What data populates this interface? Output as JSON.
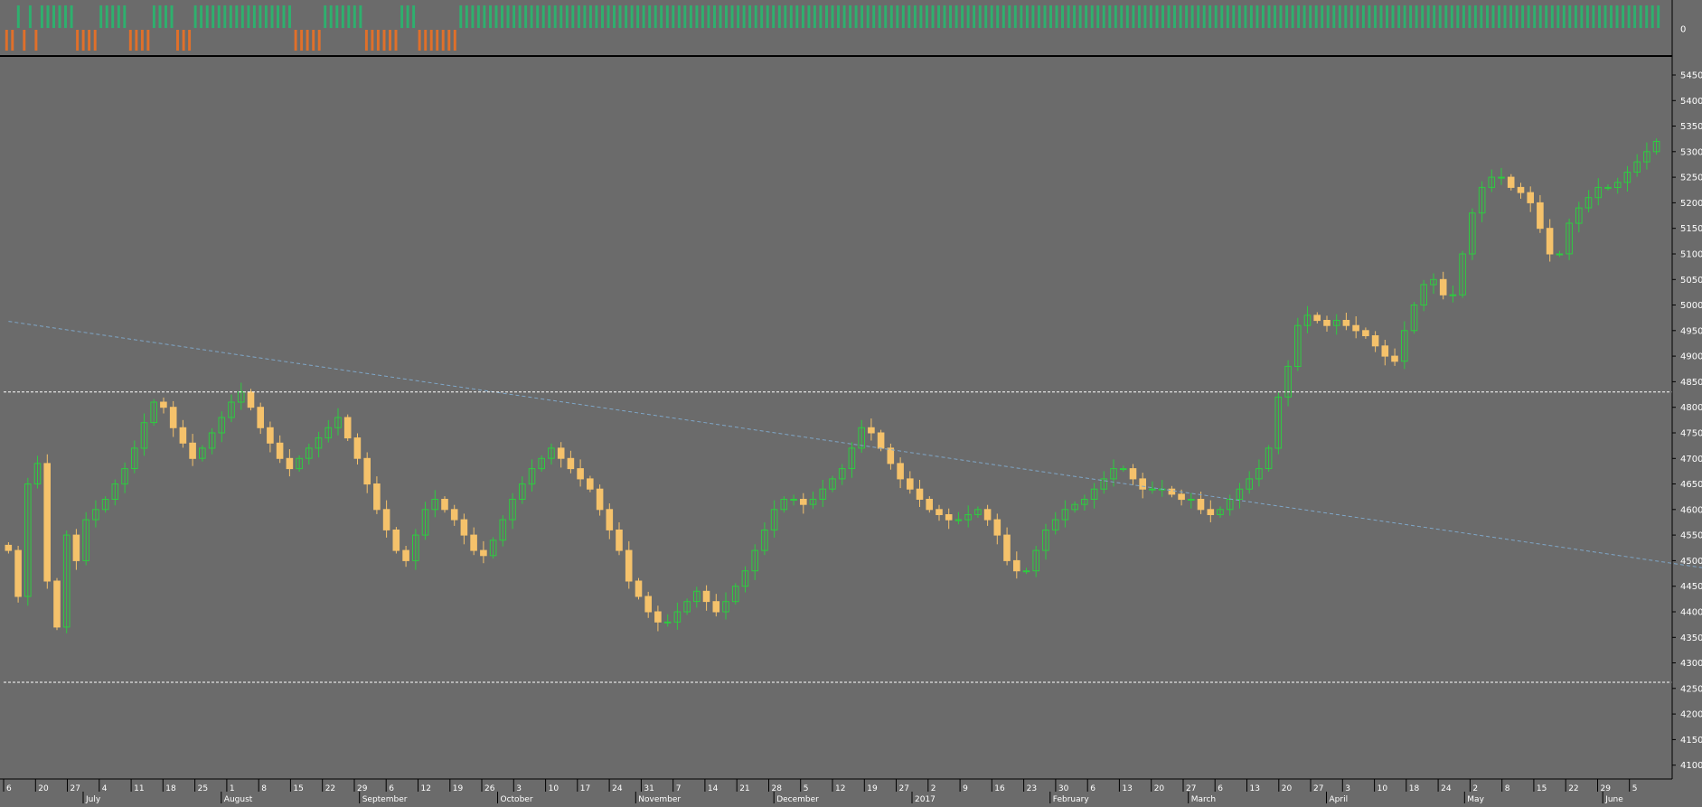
{
  "colors": {
    "background": "#6b6b6b",
    "up": "#2ecc40",
    "down": "#f5c26b",
    "volume_up": "#2eb06e",
    "volume_down": "#e0702a",
    "divider": "#000000",
    "trendline": "#7fa6c7",
    "level_line": "#ffffff",
    "axis_text": "#ffffff"
  },
  "chart_data": [
    {
      "type": "bar",
      "panel": "indicator",
      "ylim": [
        -1,
        1
      ],
      "ytick_labels": [
        {
          "value": 0,
          "label": "0"
        }
      ],
      "up_value": 1,
      "down_value": -1,
      "signals": [
        -1,
        -1,
        1,
        -1,
        1,
        -1,
        1,
        1,
        1,
        1,
        1,
        1,
        -1,
        -1,
        -1,
        -1,
        1,
        1,
        1,
        1,
        1,
        -1,
        -1,
        -1,
        -1,
        1,
        1,
        1,
        1,
        -1,
        -1,
        -1,
        1,
        1,
        1,
        1,
        1,
        1,
        1,
        1,
        1,
        1,
        1,
        1,
        1,
        1,
        1,
        1,
        1,
        -1,
        -1,
        -1,
        -1,
        -1,
        1,
        1,
        1,
        1,
        1,
        1,
        1,
        -1,
        -1,
        -1,
        -1,
        -1,
        -1,
        1,
        1,
        1,
        -1,
        -1,
        -1,
        -1,
        -1,
        -1,
        -1,
        1,
        1,
        1,
        1,
        1,
        1,
        1,
        1,
        1,
        1,
        1,
        1,
        1,
        1,
        1,
        1,
        1,
        1,
        1,
        1,
        1,
        1,
        1,
        1,
        1,
        1,
        1,
        1,
        1,
        1,
        1,
        1,
        1,
        1,
        1,
        1,
        1,
        1,
        1,
        1,
        1,
        1,
        1,
        1,
        1,
        1,
        1,
        1,
        1,
        1,
        1,
        1,
        1,
        1,
        1,
        1,
        1,
        1,
        1,
        1,
        1,
        1,
        1,
        1,
        1,
        1,
        1,
        1,
        1,
        1,
        1,
        1,
        1,
        1,
        1,
        1,
        1,
        1,
        1,
        1,
        1,
        1,
        1,
        1,
        1,
        1,
        1,
        1,
        1,
        1,
        1,
        1,
        1,
        1,
        1,
        1,
        1,
        1,
        1,
        1,
        1,
        1,
        1,
        1,
        1,
        1,
        1,
        1,
        1,
        1,
        1,
        1,
        1,
        1,
        1,
        1,
        1,
        1,
        1,
        1,
        1,
        1,
        1,
        1,
        1,
        1,
        1,
        1,
        1,
        1,
        1,
        1,
        1,
        1,
        1,
        1,
        1,
        1,
        1,
        1,
        1,
        1,
        1,
        1,
        1,
        1,
        1,
        1,
        1,
        1,
        1,
        1,
        1,
        1,
        1,
        1,
        1,
        1,
        1,
        1,
        1,
        1,
        1,
        1,
        1,
        1,
        1,
        1,
        1,
        1,
        1,
        1,
        1,
        1,
        1,
        1,
        1,
        1,
        1,
        1,
        1,
        1,
        1,
        1,
        1,
        1,
        1,
        1,
        1,
        1,
        1,
        1,
        1,
        1,
        1,
        1,
        1,
        1,
        1,
        1,
        1,
        1,
        1,
        1
      ]
    },
    {
      "type": "candlestick",
      "panel": "price",
      "ylim": [
        4080,
        5480
      ],
      "yticks": [
        4100,
        4150,
        4200,
        4250,
        4300,
        4350,
        4400,
        4450,
        4500,
        4550,
        4600,
        4650,
        4700,
        4750,
        4800,
        4850,
        4900,
        4950,
        5000,
        5050,
        5100,
        5150,
        5200,
        5250,
        5300,
        5350,
        5400,
        5450
      ],
      "close_series": [
        4520,
        4430,
        4650,
        4690,
        4460,
        4370,
        4550,
        4500,
        4580,
        4600,
        4620,
        4650,
        4680,
        4720,
        4770,
        4810,
        4800,
        4760,
        4730,
        4700,
        4720,
        4750,
        4780,
        4810,
        4830,
        4800,
        4760,
        4730,
        4700,
        4680,
        4700,
        4720,
        4740,
        4760,
        4780,
        4740,
        4700,
        4650,
        4600,
        4560,
        4520,
        4500,
        4550,
        4600,
        4620,
        4600,
        4580,
        4550,
        4520,
        4510,
        4540,
        4580,
        4620,
        4650,
        4680,
        4700,
        4720,
        4700,
        4680,
        4660,
        4640,
        4600,
        4560,
        4520,
        4460,
        4430,
        4400,
        4380,
        4380,
        4400,
        4420,
        4440,
        4420,
        4400,
        4420,
        4450,
        4480,
        4520,
        4560,
        4600,
        4620,
        4620,
        4610,
        4620,
        4640,
        4660,
        4680,
        4720,
        4760,
        4750,
        4720,
        4690,
        4660,
        4640,
        4620,
        4600,
        4590,
        4580,
        4580,
        4590,
        4600,
        4580,
        4550,
        4500,
        4480,
        4480,
        4520,
        4560,
        4580,
        4600,
        4610,
        4620,
        4640,
        4660,
        4680,
        4680,
        4660,
        4640,
        4640,
        4640,
        4630,
        4620,
        4620,
        4600,
        4590,
        4600,
        4620,
        4640,
        4660,
        4680,
        4720,
        4820,
        4880,
        4960,
        4980,
        4970,
        4960,
        4970,
        4960,
        4950,
        4940,
        4920,
        4900,
        4890,
        4950,
        5000,
        5040,
        5050,
        5020,
        5020,
        5100,
        5180,
        5230,
        5250,
        5250,
        5230,
        5220,
        5200,
        5150,
        5100,
        5100,
        5160,
        5190,
        5210,
        5230,
        5230,
        5240,
        5260,
        5280,
        5300,
        5320
      ],
      "trendline": {
        "from": [
          0,
          4968
        ],
        "to": [
          185,
          4458
        ]
      },
      "level_lines": [
        4830,
        4262
      ]
    }
  ],
  "x_axis": {
    "day_labels": [
      "6",
      "20",
      "27",
      "4",
      "11",
      "18",
      "25",
      "1",
      "8",
      "15",
      "22",
      "29",
      "6",
      "12",
      "19",
      "26",
      "3",
      "10",
      "17",
      "24",
      "31",
      "7",
      "14",
      "21",
      "28",
      "5",
      "12",
      "19",
      "27",
      "2",
      "9",
      "16",
      "23",
      "30",
      "6",
      "13",
      "20",
      "27",
      "6",
      "13",
      "20",
      "27",
      "3",
      "10",
      "18",
      "24",
      "2",
      "8",
      "15",
      "22",
      "29",
      "5"
    ],
    "month_labels": [
      "July",
      "August",
      "September",
      "October",
      "November",
      "December",
      "2017",
      "February",
      "March",
      "April",
      "May",
      "June"
    ]
  }
}
